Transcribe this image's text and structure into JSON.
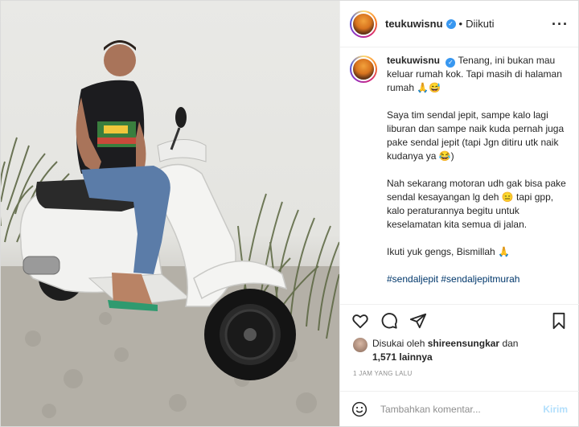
{
  "post": {
    "username": "teukuwisnu",
    "follow_status": "Diikuti",
    "more_icon": "ellipsis-icon",
    "caption": {
      "username": "teukuwisnu",
      "paragraph1": "Tenang, ini bukan mau keluar rumah kok. Tapi masih di halaman rumah 🙏😅",
      "paragraph2": "Saya tim sendal jepit, sampe kalo lagi liburan dan sampe naik kuda pernah juga pake sendal jepit (tapi Jgn ditiru utk naik kudanya ya 😂)",
      "paragraph3": "Nah sekarang motoran udh gak bisa pake sendal kesayangan lg deh 😑 tapi gpp, kalo peraturannya begitu untuk keselamatan kita semua di jalan.",
      "paragraph4": "Ikuti yuk gengs, Bismillah 🙏",
      "hashtags": "#sendaljepit #sendaljepitmurah"
    },
    "likes": {
      "prefix": "Disukai oleh",
      "user": "shireensungkar",
      "conjunction": "dan",
      "others": "1,571 lainnya"
    },
    "timestamp": "1 JAM YANG LALU",
    "comment": {
      "placeholder": "Tambahkan komentar...",
      "post_label": "Kirim"
    }
  },
  "colors": {
    "verified": "#3897f0",
    "hashtag": "#00376b",
    "post_button_disabled": "#b2dffc",
    "muted": "#8e8e8e"
  },
  "icons": [
    "heart-icon",
    "comment-icon",
    "share-icon",
    "bookmark-icon",
    "emoji-icon",
    "verified-icon"
  ]
}
